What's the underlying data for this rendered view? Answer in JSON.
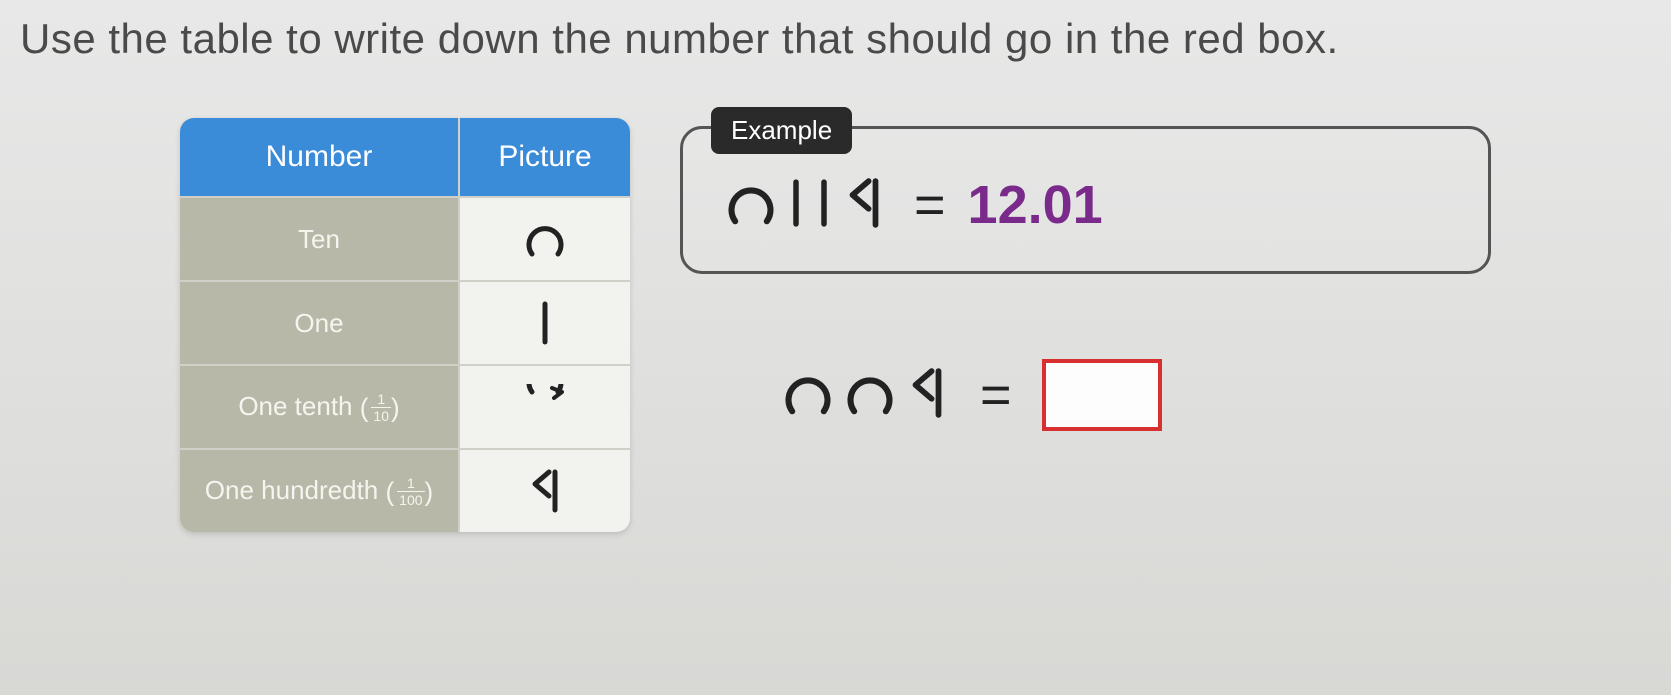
{
  "instruction": "Use the table to write down the number that should go in the red box.",
  "table": {
    "headers": [
      "Number",
      "Picture"
    ],
    "rows": [
      {
        "label": "Ten",
        "fraction": null,
        "symbol": "ten"
      },
      {
        "label": "One",
        "fraction": null,
        "symbol": "one"
      },
      {
        "label": "One tenth",
        "fraction": {
          "num": "1",
          "den": "10"
        },
        "symbol": "tenth"
      },
      {
        "label": "One hundredth",
        "fraction": {
          "num": "1",
          "den": "100"
        },
        "symbol": "hundredth"
      }
    ]
  },
  "example": {
    "tab": "Example",
    "symbols": [
      "ten",
      "one",
      "one",
      "hundredth"
    ],
    "equals": "=",
    "result": "12.01"
  },
  "problem": {
    "symbols": [
      "ten",
      "ten",
      "hundredth"
    ],
    "equals": "=",
    "answer": ""
  }
}
